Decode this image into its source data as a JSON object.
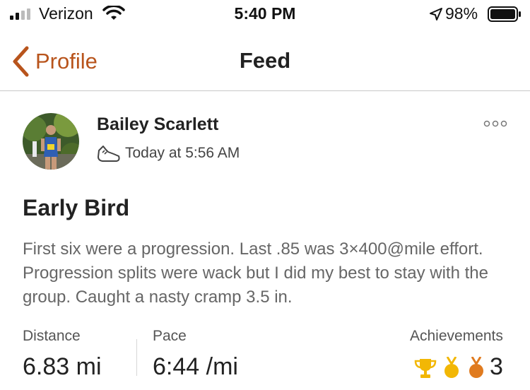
{
  "status_bar": {
    "carrier": "Verizon",
    "time": "5:40 PM",
    "battery_percent": "98%",
    "icons": [
      "signal-icon",
      "wifi-icon",
      "location-arrow-icon",
      "battery-icon"
    ]
  },
  "nav": {
    "back_label": "Profile",
    "title": "Feed"
  },
  "activity": {
    "athlete_name": "Bailey Scarlett",
    "time": "Today at 5:56 AM",
    "title": "Early Bird",
    "description": "First six were a progression. Last .85 was 3×400@mile effort. Progression splits were wack but I did my best to stay with the group. Caught a nasty cramp 3.5 in.",
    "stats": {
      "distance_label": "Distance",
      "distance_value": "6.83 mi",
      "pace_label": "Pace",
      "pace_value": "6:44 /mi",
      "achievements_label": "Achievements",
      "achievements_count": "3"
    }
  },
  "colors": {
    "accent": "#b8541c",
    "gold": "#f2b705",
    "bronze": "#e07b1f"
  }
}
